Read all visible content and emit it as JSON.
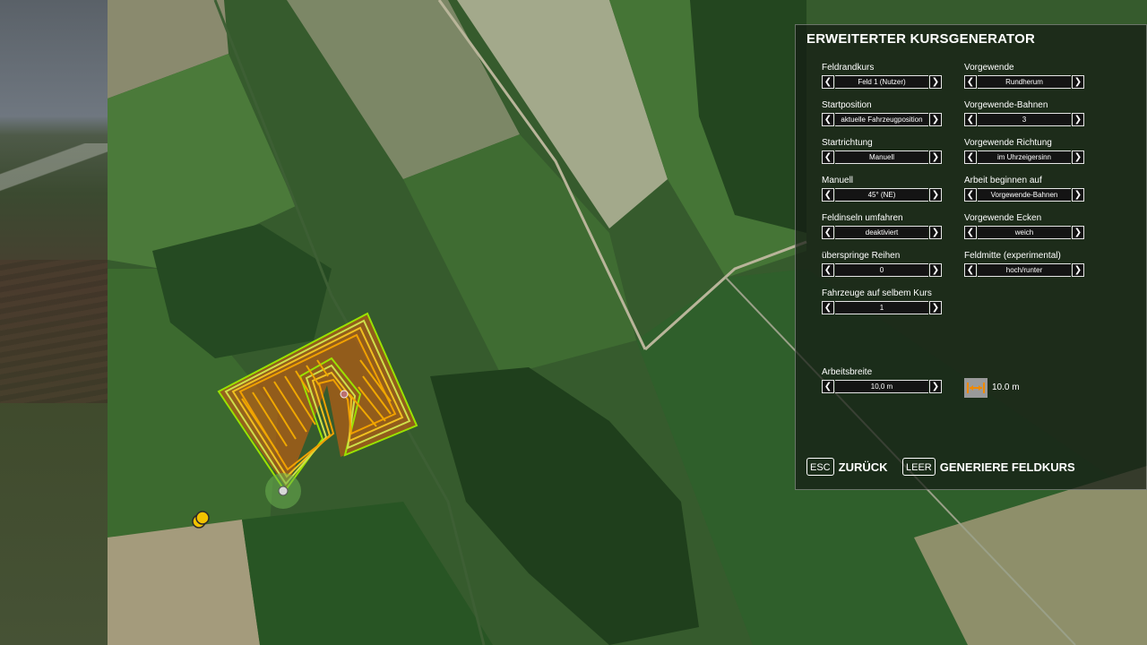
{
  "panel": {
    "title": "ERWEITERTER KURSGENERATOR",
    "fields": {
      "feldrandkurs": {
        "label": "Feldrandkurs",
        "value": "Feld 1 (Nutzer)"
      },
      "startposition": {
        "label": "Startposition",
        "value": "aktuelle Fahrzeugposition"
      },
      "startrichtung": {
        "label": "Startrichtung",
        "value": "Manuell"
      },
      "manuell": {
        "label": "Manuell",
        "value": "45° (NE)"
      },
      "feldinseln": {
        "label": "Feldinseln umfahren",
        "value": "deaktiviert"
      },
      "ueberspringe": {
        "label": "überspringe Reihen",
        "value": "0"
      },
      "fahrzeuge": {
        "label": "Fahrzeuge auf selbem Kurs",
        "value": "1"
      },
      "vorgewende": {
        "label": "Vorgewende",
        "value": "Rundherum"
      },
      "vorgewende_bahnen": {
        "label": "Vorgewende-Bahnen",
        "value": "3"
      },
      "vorgewende_richtung": {
        "label": "Vorgewende Richtung",
        "value": "im Uhrzeigersinn"
      },
      "arbeit_beginnen": {
        "label": "Arbeit beginnen auf",
        "value": "Vorgewende-Bahnen"
      },
      "vorgewende_ecken": {
        "label": "Vorgewende Ecken",
        "value": "weich"
      },
      "feldmitte": {
        "label": "Feldmitte (experimental)",
        "value": "hoch/runter"
      },
      "arbeitsbreite": {
        "label": "Arbeitsbreite",
        "value": "10,0 m"
      }
    },
    "width_display": "10.0 m",
    "width_icon": "arrow-width-icon",
    "actions": {
      "back": {
        "key": "ESC",
        "label": "ZURÜCK"
      },
      "generate": {
        "key": "LEER",
        "label": "GENERIERE FELDKURS"
      }
    }
  },
  "colors": {
    "course_outer": "#8fe000",
    "course_fill": "#f0a000",
    "course_inner": "#e05a10",
    "marker": "#f2c200"
  }
}
